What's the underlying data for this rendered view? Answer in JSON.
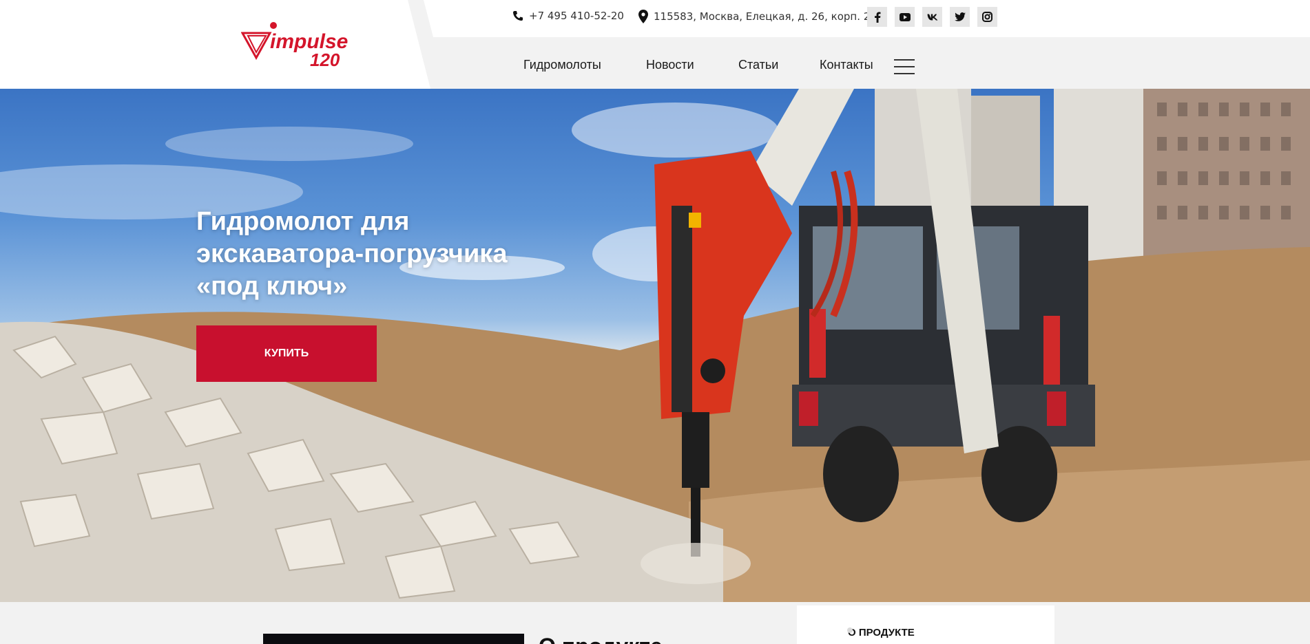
{
  "header": {
    "logo": {
      "brand": "impulse",
      "model": "120",
      "color": "#d4152b"
    },
    "phone": {
      "icon": "phone-icon",
      "text": "+7 495 410-52-20"
    },
    "address": {
      "icon": "map-pin-icon",
      "text": "115583, Москва, Елецкая, д. 26, корп. 2"
    },
    "socials": [
      {
        "name": "facebook",
        "icon": "facebook-icon"
      },
      {
        "name": "youtube",
        "icon": "youtube-icon"
      },
      {
        "name": "vk",
        "icon": "vk-icon"
      },
      {
        "name": "twitter",
        "icon": "twitter-icon"
      },
      {
        "name": "instagram",
        "icon": "instagram-icon"
      }
    ],
    "nav": [
      {
        "label": "Гидромолоты"
      },
      {
        "label": "Новости"
      },
      {
        "label": "Статьи"
      },
      {
        "label": "Контакты"
      }
    ],
    "menu_icon": "hamburger-menu-icon"
  },
  "hero": {
    "title_line1": "Гидромолот для",
    "title_line2": "экскаватора-погрузчика",
    "title_line3": "«под ключ»",
    "buy_label": "КУПИТЬ",
    "accent": "#c8102e"
  },
  "about": {
    "heading": "О продукте",
    "side_item": "О ПРОДУКТЕ"
  }
}
